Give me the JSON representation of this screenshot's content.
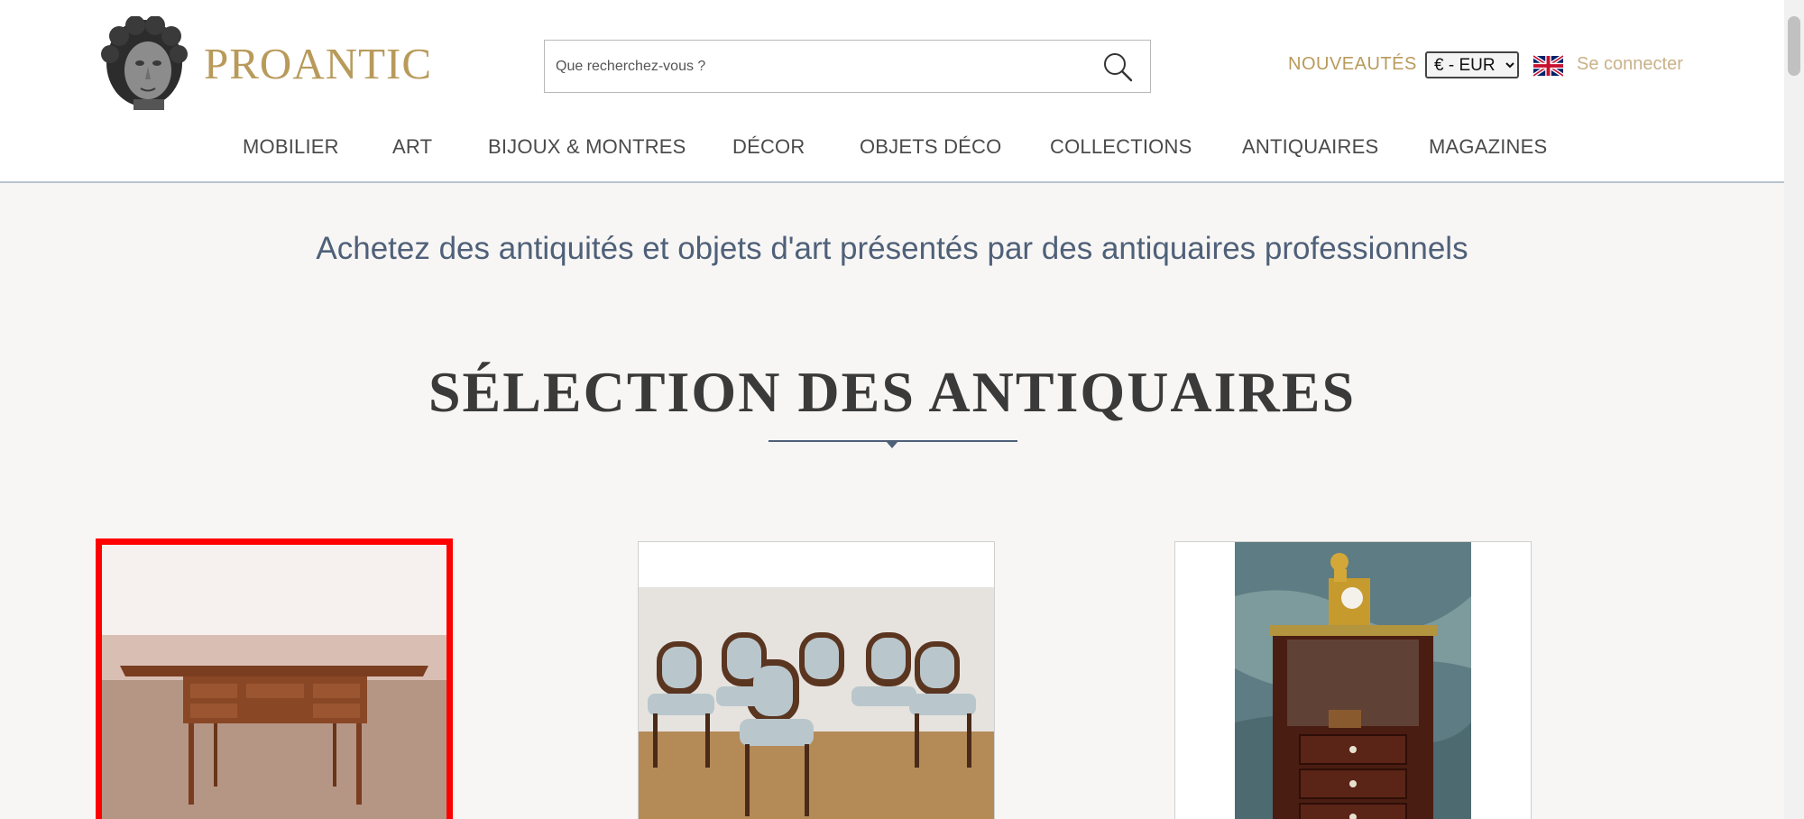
{
  "header": {
    "logo_text": "PROANTIC",
    "search": {
      "placeholder": "Que recherchez-vous ?",
      "value": ""
    },
    "nouveautes_label": "NOUVEAUTÉS",
    "currency": {
      "selected": "€ - EUR",
      "options": [
        "€ - EUR"
      ]
    },
    "language_flag_icon": "uk-flag-icon",
    "login_label": "Se connecter"
  },
  "nav": {
    "items": [
      {
        "label": "MOBILIER"
      },
      {
        "label": "ART"
      },
      {
        "label": "BIJOUX & MONTRES"
      },
      {
        "label": "DÉCOR"
      },
      {
        "label": "OBJETS DÉCO"
      },
      {
        "label": "COLLECTIONS"
      },
      {
        "label": "ANTIQUAIRES"
      },
      {
        "label": "MAGAZINES"
      }
    ]
  },
  "main": {
    "tagline": "Achetez des antiquités et objets d'art présentés par des antiquaires professionnels",
    "section_title": "SÉLECTION DES ANTIQUAIRES",
    "cards": [
      {
        "image": "writing-desk-photo",
        "selected": true
      },
      {
        "image": "dining-chairs-photo",
        "selected": false
      },
      {
        "image": "clock-on-cabinet-photo",
        "selected": false
      }
    ]
  },
  "colors": {
    "brand_gold": "#b89a5b",
    "accent_blue": "#4f6079",
    "selection_outline": "#ff0000",
    "page_background": "#f7f6f4"
  }
}
